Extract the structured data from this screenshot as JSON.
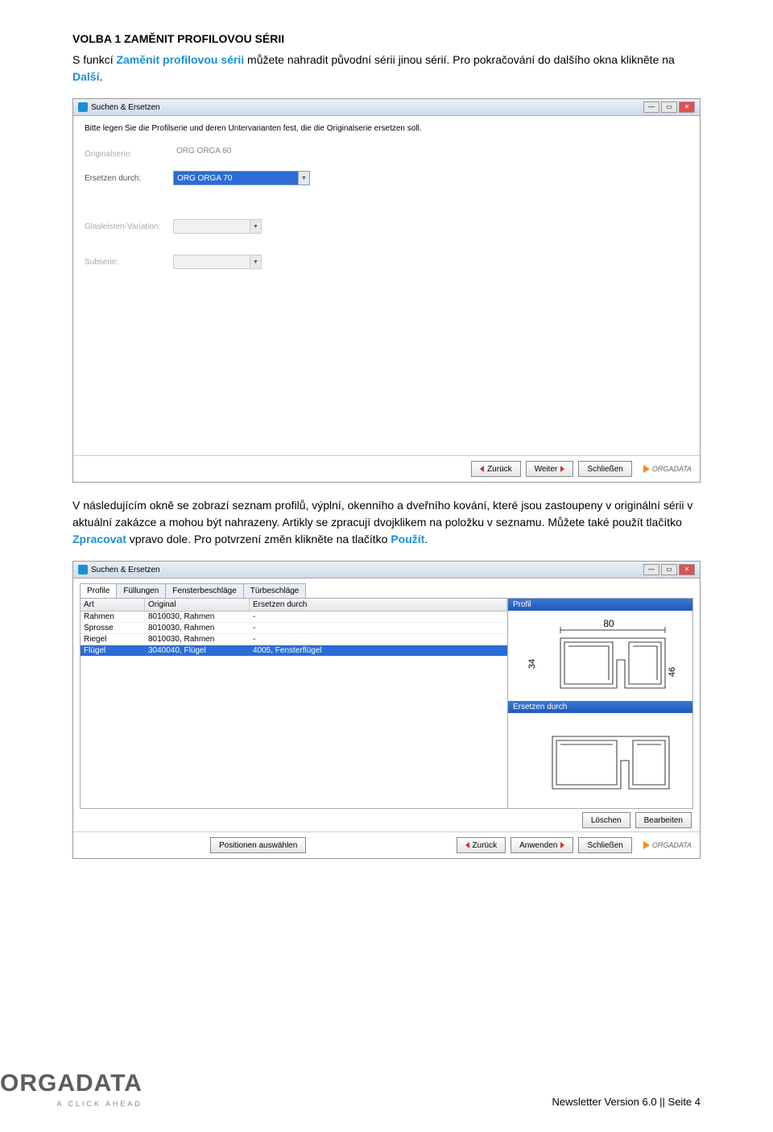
{
  "heading": "VOLBA 1 ZAMĚNIT PROFILOVOU SÉRII",
  "para1_a": "S funkcí ",
  "para1_kw1": "Zaměnit profilovou sérii",
  "para1_b": " můžete nahradit původní sérii jinou sérií. Pro pokračování do dalšího okna klikněte na  ",
  "para1_kw2": "Další",
  "para1_c": ".",
  "dialog1": {
    "title": "Suchen & Ersetzen",
    "prompt": "Bitte legen Sie die Profilserie und deren Untervarianten fest, die die Originalserie ersetzen soll.",
    "fields": {
      "original_lbl": "Originalserie:",
      "original_val": "ORG ORGA 80",
      "replace_lbl": "Ersetzen durch:",
      "replace_val": "ORG ORGA 70",
      "glas_lbl": "Glasleisten-Variation:",
      "sub_lbl": "Subserie:"
    },
    "btn_back": "Zurück",
    "btn_next": "Weiter",
    "btn_close": "Schließen",
    "brand": "ORGADATA"
  },
  "para2_a": "V následujícím okně se zobrazí seznam profilů, výplní, okenního a dveřního kování, které jsou zastoupeny v originální sérii v aktuální zakázce a mohou být nahrazeny. Artikly se zpracují dvojklikem na položku v seznamu. Můžete také použít tlačítko ",
  "para2_kw1": "Zpracovat",
  "para2_b": " vpravo dole. Pro potvrzení změn klikněte na tlačítko ",
  "para2_kw2": "Použít",
  "para2_c": ".",
  "dialog2": {
    "title": "Suchen & Ersetzen",
    "tabs": [
      "Profile",
      "Füllungen",
      "Fensterbeschläge",
      "Türbeschläge"
    ],
    "columns": [
      "Art",
      "Original",
      "Ersetzen durch"
    ],
    "rows": [
      {
        "art": "Rahmen",
        "orig": "8010030, Rahmen",
        "rep": "-"
      },
      {
        "art": "Sprosse",
        "orig": "8010030, Rahmen",
        "rep": "-"
      },
      {
        "art": "Riegel",
        "orig": "8010030, Rahmen",
        "rep": "-"
      },
      {
        "art": "Flügel",
        "orig": "3040040, Flügel",
        "rep": "4005, Fensterflügel",
        "selected": true
      }
    ],
    "preview_top": "Profil",
    "preview_bottom": "Ersetzen durch",
    "dim_top": "80",
    "dim_left": "34",
    "dim_right": "46",
    "btn_pos": "Positionen auswählen",
    "btn_back": "Zurück",
    "btn_apply": "Anwenden",
    "btn_close": "Schließen",
    "btn_del": "Löschen",
    "btn_edit": "Bearbeiten",
    "brand": "ORGADATA"
  },
  "footer": {
    "brand": "ORGADATA",
    "tag": "A CLICK AHEAD",
    "right": "Newsletter Version 6.0 || Seite 4"
  }
}
